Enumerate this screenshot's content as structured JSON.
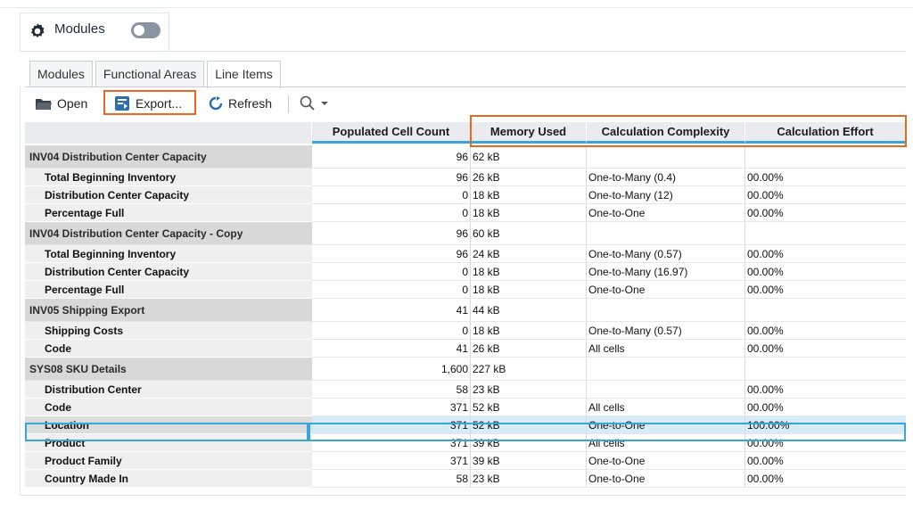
{
  "header": {
    "title": "Modules",
    "toggle_state": "off"
  },
  "tabs": [
    {
      "label": "Modules",
      "active": false
    },
    {
      "label": "Functional Areas",
      "active": false
    },
    {
      "label": "Line Items",
      "active": true
    }
  ],
  "toolbar": {
    "open_label": "Open",
    "export_label": "Export...",
    "refresh_label": "Refresh",
    "search_icon": "search-icon",
    "accent": "#e8671e"
  },
  "columns": [
    "",
    "Populated Cell Count",
    "Memory Used",
    "Calculation Complexity",
    "Calculation Effort"
  ],
  "rows": [
    {
      "type": "group",
      "name": "INV04 Distribution Center Capacity",
      "count": "96",
      "memory": "62 kB",
      "complexity": "",
      "effort": ""
    },
    {
      "type": "child",
      "name": "Total Beginning Inventory",
      "count": "96",
      "memory": "26 kB",
      "complexity": "One-to-Many (0.4)",
      "effort": "00.00%"
    },
    {
      "type": "child",
      "name": "Distribution Center Capacity",
      "count": "0",
      "memory": "18 kB",
      "complexity": "One-to-Many (12)",
      "effort": "00.00%"
    },
    {
      "type": "child",
      "name": "Percentage Full",
      "count": "0",
      "memory": "18 kB",
      "complexity": "One-to-One",
      "effort": "00.00%"
    },
    {
      "type": "group",
      "name": "INV04 Distribution Center Capacity - Copy",
      "count": "96",
      "memory": "60 kB",
      "complexity": "",
      "effort": ""
    },
    {
      "type": "child",
      "name": "Total Beginning Inventory",
      "count": "96",
      "memory": "24 kB",
      "complexity": "One-to-Many (0.57)",
      "effort": "00.00%"
    },
    {
      "type": "child",
      "name": "Distribution Center Capacity",
      "count": "0",
      "memory": "18 kB",
      "complexity": "One-to-Many (16.97)",
      "effort": "00.00%"
    },
    {
      "type": "child",
      "name": "Percentage Full",
      "count": "0",
      "memory": "18 kB",
      "complexity": "One-to-One",
      "effort": "00.00%"
    },
    {
      "type": "group",
      "name": "INV05 Shipping Export",
      "count": "41",
      "memory": "44 kB",
      "complexity": "",
      "effort": ""
    },
    {
      "type": "child",
      "name": "Shipping Costs",
      "count": "0",
      "memory": "18 kB",
      "complexity": "One-to-Many (0.57)",
      "effort": "00.00%"
    },
    {
      "type": "child",
      "name": "Code",
      "count": "41",
      "memory": "26 kB",
      "complexity": "All cells",
      "effort": "00.00%"
    },
    {
      "type": "group",
      "name": "SYS08 SKU Details",
      "count": "1,600",
      "memory": "227 kB",
      "complexity": "",
      "effort": ""
    },
    {
      "type": "child",
      "name": "Distribution Center",
      "count": "58",
      "memory": "23 kB",
      "complexity": "",
      "effort": "00.00%"
    },
    {
      "type": "child",
      "name": "Code",
      "count": "371",
      "memory": "52 kB",
      "complexity": "All cells",
      "effort": "00.00%"
    },
    {
      "type": "child",
      "name": "Location",
      "count": "371",
      "memory": "52 kB",
      "complexity": "One-to-One",
      "effort": "100.00%",
      "selected": true
    },
    {
      "type": "child",
      "name": "Product",
      "count": "371",
      "memory": "39 kB",
      "complexity": "All cells",
      "effort": "00.00%"
    },
    {
      "type": "child",
      "name": "Product Family",
      "count": "371",
      "memory": "39 kB",
      "complexity": "One-to-One",
      "effort": "00.00%"
    },
    {
      "type": "child",
      "name": "Country Made In",
      "count": "58",
      "memory": "23 kB",
      "complexity": "One-to-One",
      "effort": "00.00%"
    }
  ]
}
